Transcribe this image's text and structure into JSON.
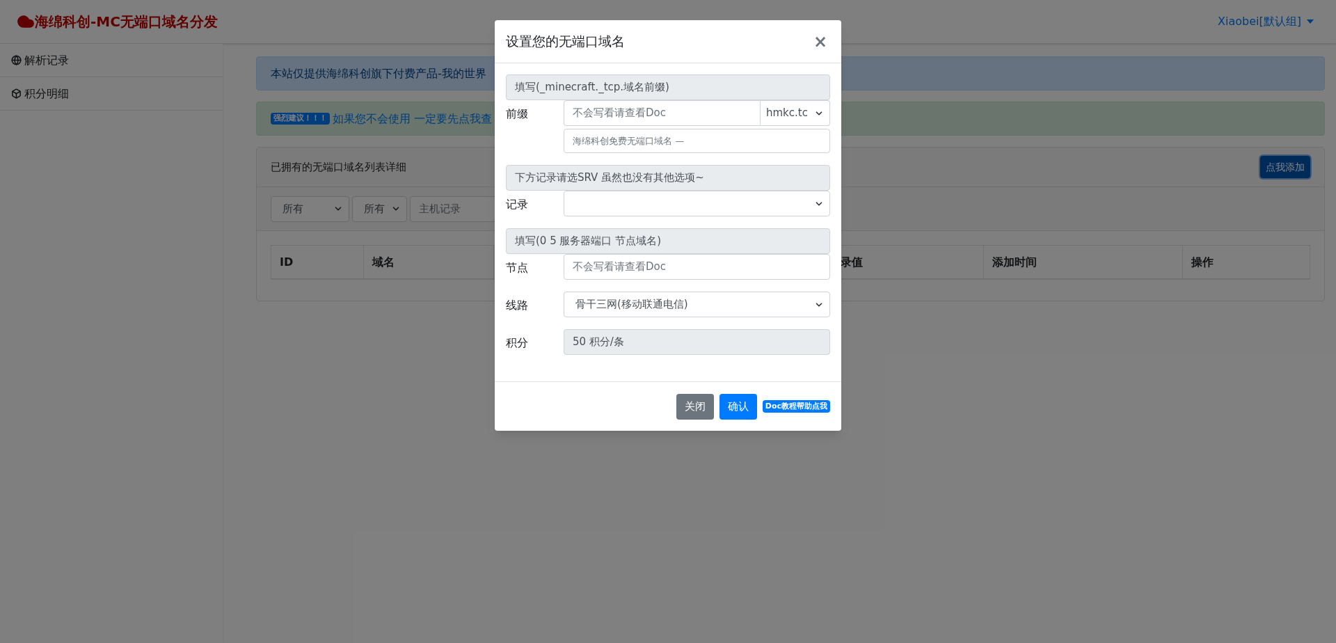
{
  "header": {
    "brand": "海绵科创-MC无端口域名分发",
    "user": "Xiaobei[默认组]"
  },
  "sidebar": {
    "items": [
      {
        "label": "解析记录"
      },
      {
        "label": "积分明细"
      }
    ]
  },
  "alerts": [
    {
      "kind": "info",
      "text": "本站仅提供海绵科创旗下付费产品-我的世界"
    },
    {
      "kind": "success",
      "badge": "强烈建议！！！",
      "link": "如果您不会使用 一定要先点我查"
    }
  ],
  "card": {
    "title": "已拥有的无端口域名列表详细",
    "add_button": "点我添加",
    "filters": [
      {
        "kind": "select",
        "value": "所有"
      },
      {
        "kind": "select",
        "value": "所有"
      },
      {
        "kind": "input",
        "placeholder": "主机记录"
      }
    ],
    "columns": [
      "ID",
      "域名",
      "录值",
      "添加时间",
      "操作"
    ]
  },
  "modal": {
    "title": "设置您的无端口域名",
    "close": "×",
    "rows": [
      {
        "kind": "section",
        "text": "填写(_minecraft._tcp.域名前缀)"
      },
      {
        "kind": "input-select",
        "label": "前缀",
        "placeholder": "不会写看请查看Doc",
        "select": "hmkc.tc"
      },
      {
        "kind": "hint",
        "placeholder": "海绵科创免费无端口域名 —"
      },
      {
        "kind": "section",
        "text": "下方记录请选SRV 虽然也没有其他选项~"
      },
      {
        "kind": "select",
        "label": "记录"
      },
      {
        "kind": "section",
        "text": "填写(0 5 服务器端口 节点域名)"
      },
      {
        "kind": "input",
        "label": "节点",
        "placeholder": "不会写看请查看Doc"
      },
      {
        "kind": "select",
        "label": "线路",
        "value": "骨干三网(移动联通电信)"
      },
      {
        "kind": "readonly",
        "label": "积分",
        "value": "50 积分/条"
      }
    ],
    "buttons": [
      {
        "kind": "secondary",
        "label": "关闭"
      },
      {
        "kind": "primary",
        "label": "确认"
      },
      {
        "kind": "badge",
        "label": "Doc教程帮助点我"
      }
    ]
  }
}
